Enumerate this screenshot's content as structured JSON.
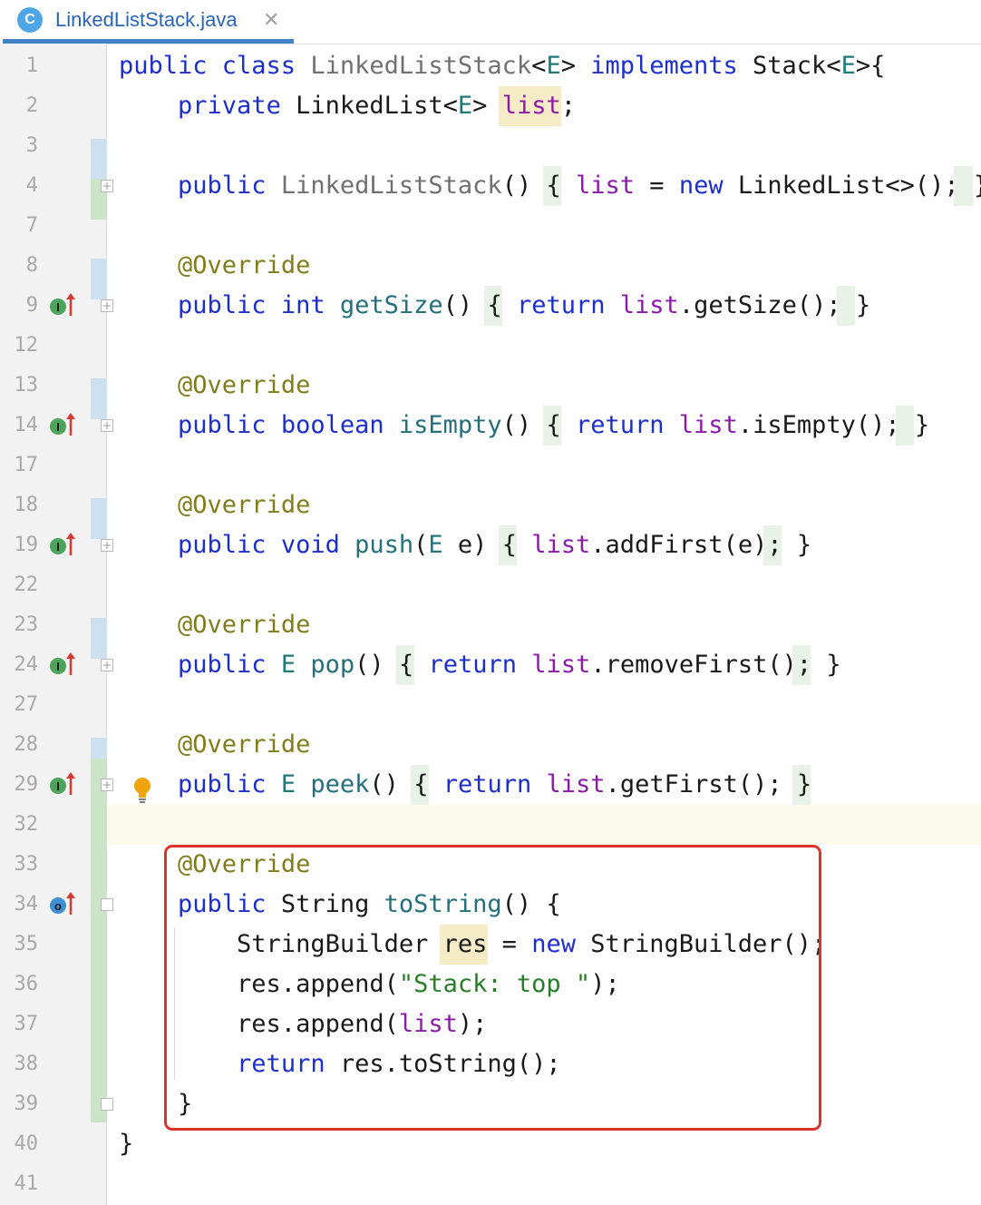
{
  "tab": {
    "file_icon_letter": "C",
    "file_name": "LinkedListStack.java",
    "close_glyph": "✕",
    "file_icon_name": "java-class-icon",
    "close_icon_name": "close-icon"
  },
  "gutter": {
    "line_numbers": [
      "1",
      "2",
      "3",
      "4",
      "7",
      "8",
      "9",
      "12",
      "13",
      "14",
      "17",
      "18",
      "19",
      "22",
      "23",
      "24",
      "27",
      "28",
      "29",
      "32",
      "33",
      "34",
      "35",
      "36",
      "37",
      "38",
      "39",
      "40",
      "41"
    ],
    "override_icons": [
      "implements-method-icon",
      "overrides-method-icon"
    ],
    "bulb_icon": "lightbulb-icon",
    "fold_icon": "fold-marker-icon"
  },
  "editor": {
    "current_line": "32",
    "highlighted_section_lines": [
      "33",
      "39"
    ],
    "lines": [
      [
        "public class ",
        "LinkedListStack",
        "<",
        "E",
        "> ",
        "implements",
        " Stack<",
        "E",
        ">{"
      ],
      [
        "    ",
        "private",
        " LinkedList<",
        "E",
        "> ",
        "list",
        ";"
      ],
      [],
      [
        "    ",
        "public",
        " ",
        "LinkedListStack",
        "() ",
        "{",
        " ",
        "list",
        " = ",
        "new",
        " LinkedList<>();",
        " ",
        "}"
      ],
      [],
      [
        "    ",
        "@Override"
      ],
      [
        "    ",
        "public int",
        " ",
        "getSize",
        "() ",
        "{",
        " ",
        "return",
        " ",
        "list",
        ".getSize();",
        " ",
        "}"
      ],
      [],
      [
        "    ",
        "@Override"
      ],
      [
        "    ",
        "public boolean",
        " ",
        "isEmpty",
        "() ",
        "{",
        " ",
        "return",
        " ",
        "list",
        ".isEmpty();",
        " ",
        "}"
      ],
      [],
      [
        "    ",
        "@Override"
      ],
      [
        "    ",
        "public void",
        " ",
        "push",
        "(",
        "E",
        " e) ",
        "{",
        " ",
        "list",
        ".addFirst(e);",
        " ",
        "}"
      ],
      [],
      [
        "    ",
        "@Override"
      ],
      [
        "    ",
        "public",
        " ",
        "E",
        " ",
        "pop",
        "() ",
        "{",
        " ",
        "return",
        " ",
        "list",
        ".removeFirst();",
        " ",
        "}"
      ],
      [],
      [
        "    ",
        "@Override"
      ],
      [
        "    ",
        "public",
        " ",
        "E",
        " ",
        "peek",
        "() ",
        "{",
        " ",
        "return",
        " ",
        "list",
        ".getFirst();",
        " ",
        "}"
      ],
      [],
      [
        "    ",
        "@Override"
      ],
      [
        "    ",
        "public",
        " String ",
        "toString",
        "() {"
      ],
      [
        "        StringBuilder ",
        "res",
        " = ",
        "new",
        " StringBuilder();"
      ],
      [
        "        res.append(",
        "\"Stack: top \"",
        ");"
      ],
      [
        "        res.append(",
        "list",
        ");"
      ],
      [
        "        ",
        "return",
        " res.toString();"
      ],
      [
        "    }"
      ],
      [
        "}"
      ],
      []
    ]
  }
}
